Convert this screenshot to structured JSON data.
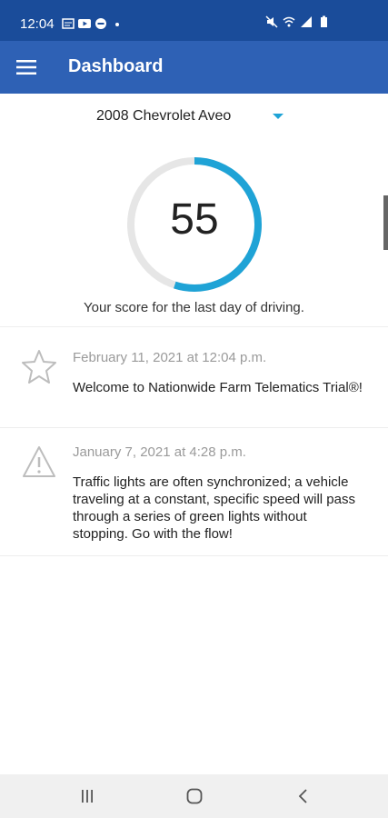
{
  "status_bar": {
    "time": "12:04",
    "icons_left": [
      "notification-card-icon",
      "youtube-icon",
      "do-not-disturb-icon",
      "dot-icon"
    ],
    "icons_right": [
      "mute-icon",
      "wifi-icon",
      "signal-icon",
      "battery-icon"
    ]
  },
  "app_bar": {
    "title": "Dashboard",
    "menu_icon": "hamburger-menu-icon",
    "color": "#2e61b5",
    "status_color": "#1a4c9a"
  },
  "vehicle": {
    "selected": "2008 Chevrolet Aveo",
    "accent": "#1fa3d6"
  },
  "score": {
    "value": "55",
    "max": 100,
    "caption": "Your score for the last day of driving.",
    "ring_color": "#1fa3d6",
    "track_color": "#e6e6e6"
  },
  "messages": [
    {
      "icon": "star-icon",
      "date": "February 11, 2021 at 12:04 p.m.",
      "text": "Welcome to Nationwide Farm Telematics Trial®!"
    },
    {
      "icon": "warning-icon",
      "date": "January 7, 2021 at 4:28 p.m.",
      "text": "Traffic lights are often synchronized; a vehicle traveling at a constant, specific speed will pass through a series of green lights without stopping. Go with the flow!"
    }
  ],
  "nav_bar": {
    "buttons": [
      "recent-apps-icon",
      "home-icon",
      "back-icon"
    ]
  }
}
